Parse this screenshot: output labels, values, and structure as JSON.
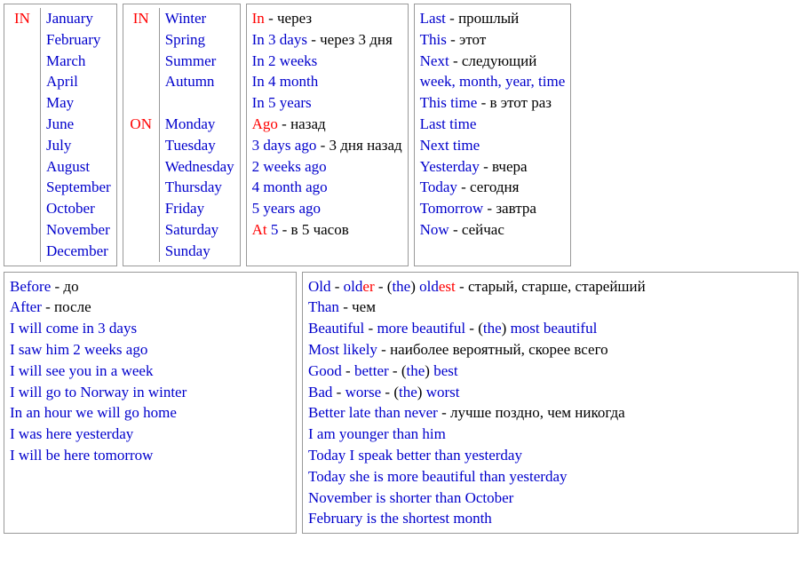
{
  "box1": {
    "label": "IN",
    "items": [
      "January",
      "February",
      "March",
      "April",
      "May",
      "June",
      "July",
      "August",
      "September",
      "October",
      "November",
      "December"
    ]
  },
  "box2": {
    "label1": "IN",
    "seasons": [
      "Winter",
      "Spring",
      "Summer",
      "Autumn"
    ],
    "label2": "ON",
    "days": [
      "Monday",
      "Tuesday",
      "Wednesday",
      "Thursday",
      "Friday",
      "Saturday",
      "Sunday"
    ]
  },
  "box3": {
    "lines": [
      {
        "parts": [
          {
            "t": "In",
            "c": "red"
          },
          {
            "t": " - через",
            "c": ""
          }
        ]
      },
      {
        "parts": [
          {
            "t": "In 3 days",
            "c": "blue"
          },
          {
            "t": " - через 3 дня",
            "c": ""
          }
        ]
      },
      {
        "parts": [
          {
            "t": "In 2 weeks",
            "c": "blue"
          }
        ]
      },
      {
        "parts": [
          {
            "t": "In 4 month",
            "c": "blue"
          }
        ]
      },
      {
        "parts": [
          {
            "t": "In 5 years",
            "c": "blue"
          }
        ]
      },
      {
        "parts": [
          {
            "t": "Ago",
            "c": "red"
          },
          {
            "t": " - назад",
            "c": ""
          }
        ]
      },
      {
        "parts": [
          {
            "t": "3 days ago",
            "c": "blue"
          },
          {
            "t": " - 3 дня назад",
            "c": ""
          }
        ]
      },
      {
        "parts": [
          {
            "t": "2 weeks ago",
            "c": "blue"
          }
        ]
      },
      {
        "parts": [
          {
            "t": "4 month ago",
            "c": "blue"
          }
        ]
      },
      {
        "parts": [
          {
            "t": "5 years ago",
            "c": "blue"
          }
        ]
      },
      {
        "parts": [
          {
            "t": "At",
            "c": "red"
          },
          {
            "t": " 5",
            "c": "blue"
          },
          {
            "t": " - в 5 часов",
            "c": ""
          }
        ]
      }
    ]
  },
  "box4": {
    "lines": [
      {
        "parts": [
          {
            "t": "Last",
            "c": "blue"
          },
          {
            "t": " - прошлый",
            "c": ""
          }
        ]
      },
      {
        "parts": [
          {
            "t": "This",
            "c": "blue"
          },
          {
            "t": " - этот",
            "c": ""
          }
        ]
      },
      {
        "parts": [
          {
            "t": "Next",
            "c": "blue"
          },
          {
            "t": " - следующий",
            "c": ""
          }
        ]
      },
      {
        "parts": [
          {
            "t": "week, month, year, time",
            "c": "blue"
          }
        ]
      },
      {
        "parts": [
          {
            "t": "This time",
            "c": "blue"
          },
          {
            "t": " - в этот раз",
            "c": ""
          }
        ]
      },
      {
        "parts": [
          {
            "t": "Last time",
            "c": "blue"
          }
        ]
      },
      {
        "parts": [
          {
            "t": "Next time",
            "c": "blue"
          }
        ]
      },
      {
        "parts": [
          {
            "t": "Yesterday",
            "c": "blue"
          },
          {
            "t": " - вчера",
            "c": ""
          }
        ]
      },
      {
        "parts": [
          {
            "t": "Today",
            "c": "blue"
          },
          {
            "t": " - сегодня",
            "c": ""
          }
        ]
      },
      {
        "parts": [
          {
            "t": "Tomorrow",
            "c": "blue"
          },
          {
            "t": " - завтра",
            "c": ""
          }
        ]
      },
      {
        "parts": [
          {
            "t": "Now",
            "c": "blue"
          },
          {
            "t": " - сейчас",
            "c": ""
          }
        ]
      }
    ]
  },
  "box5": {
    "lines": [
      {
        "parts": [
          {
            "t": "Before",
            "c": "blue"
          },
          {
            "t": " - до",
            "c": ""
          }
        ]
      },
      {
        "parts": [
          {
            "t": "After",
            "c": "blue"
          },
          {
            "t": " - после",
            "c": ""
          }
        ]
      },
      {
        "parts": [
          {
            "t": "I will come in 3 days",
            "c": "blue"
          }
        ]
      },
      {
        "parts": [
          {
            "t": "I saw him 2 weeks ago",
            "c": "blue"
          }
        ]
      },
      {
        "parts": [
          {
            "t": "I will see you in a week",
            "c": "blue"
          }
        ]
      },
      {
        "parts": [
          {
            "t": "I will go to Norway in winter",
            "c": "blue"
          }
        ]
      },
      {
        "parts": [
          {
            "t": "In an hour we will go home",
            "c": "blue"
          }
        ]
      },
      {
        "parts": [
          {
            "t": "I was here yesterday",
            "c": "blue"
          }
        ]
      },
      {
        "parts": [
          {
            "t": "I will be here tomorrow",
            "c": "blue"
          }
        ]
      }
    ]
  },
  "box6": {
    "lines": [
      {
        "parts": [
          {
            "t": "Old",
            "c": "blue"
          },
          {
            "t": " - ",
            "c": ""
          },
          {
            "t": "old",
            "c": "blue"
          },
          {
            "t": "er",
            "c": "red"
          },
          {
            "t": " - (",
            "c": ""
          },
          {
            "t": "the",
            "c": "blue"
          },
          {
            "t": ") ",
            "c": ""
          },
          {
            "t": "old",
            "c": "blue"
          },
          {
            "t": "est",
            "c": "red"
          },
          {
            "t": " - старый, старше, старейший",
            "c": ""
          }
        ]
      },
      {
        "parts": [
          {
            "t": "Than",
            "c": "blue"
          },
          {
            "t": " - чем",
            "c": ""
          }
        ]
      },
      {
        "parts": [
          {
            "t": "Beautiful",
            "c": "blue"
          },
          {
            "t": " - ",
            "c": ""
          },
          {
            "t": "more beautiful",
            "c": "blue"
          },
          {
            "t": " - (",
            "c": ""
          },
          {
            "t": "the",
            "c": "blue"
          },
          {
            "t": ") ",
            "c": ""
          },
          {
            "t": "most beautiful",
            "c": "blue"
          }
        ]
      },
      {
        "parts": [
          {
            "t": "Most likely",
            "c": "blue"
          },
          {
            "t": " - наиболее вероятный, скорее всего",
            "c": ""
          }
        ]
      },
      {
        "parts": [
          {
            "t": "Good",
            "c": "blue"
          },
          {
            "t": " - ",
            "c": ""
          },
          {
            "t": "better",
            "c": "blue"
          },
          {
            "t": " - (",
            "c": ""
          },
          {
            "t": "the",
            "c": "blue"
          },
          {
            "t": ") ",
            "c": ""
          },
          {
            "t": "best",
            "c": "blue"
          }
        ]
      },
      {
        "parts": [
          {
            "t": "Bad",
            "c": "blue"
          },
          {
            "t": " - ",
            "c": ""
          },
          {
            "t": "worse",
            "c": "blue"
          },
          {
            "t": " - (",
            "c": ""
          },
          {
            "t": "the",
            "c": "blue"
          },
          {
            "t": ") ",
            "c": ""
          },
          {
            "t": "worst",
            "c": "blue"
          }
        ]
      },
      {
        "parts": [
          {
            "t": "Better late than never",
            "c": "blue"
          },
          {
            "t": " - лучше поздно, чем никогда",
            "c": ""
          }
        ]
      },
      {
        "parts": [
          {
            "t": "I am younger than him",
            "c": "blue"
          }
        ]
      },
      {
        "parts": [
          {
            "t": "Today I speak better than yesterday",
            "c": "blue"
          }
        ]
      },
      {
        "parts": [
          {
            "t": "Today she is more beautiful than yesterday",
            "c": "blue"
          }
        ]
      },
      {
        "parts": [
          {
            "t": "November is shorter than October",
            "c": "blue"
          }
        ]
      },
      {
        "parts": [
          {
            "t": "February is the shortest month",
            "c": "blue"
          }
        ]
      }
    ]
  }
}
